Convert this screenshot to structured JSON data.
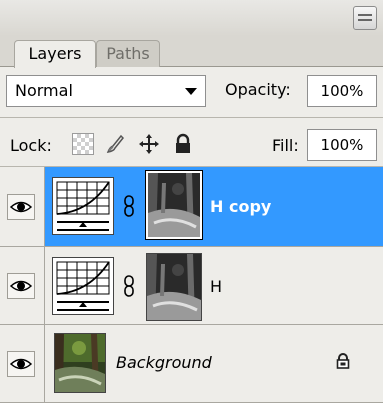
{
  "tabs": [
    {
      "label": "Layers",
      "active": true
    },
    {
      "label": "Paths",
      "active": false
    }
  ],
  "blend": {
    "mode": "Normal"
  },
  "opacity": {
    "label": "Opacity:",
    "value": "100%"
  },
  "lock": {
    "label": "Lock:",
    "icons": [
      "lock-transparent-icon",
      "lock-brush-icon",
      "lock-move-icon",
      "lock-all-icon"
    ]
  },
  "fill": {
    "label": "Fill:",
    "value": "100%"
  },
  "layers": [
    {
      "name": "H copy",
      "type": "curves-adjustment",
      "selected": true,
      "visible": true
    },
    {
      "name": "H",
      "type": "curves-adjustment",
      "selected": false,
      "visible": true
    },
    {
      "name": "Background",
      "type": "image",
      "selected": false,
      "visible": true,
      "locked": true
    }
  ],
  "colors": {
    "selection": "#3399ff",
    "panel": "#eeede9",
    "border": "#a9a7a0"
  }
}
